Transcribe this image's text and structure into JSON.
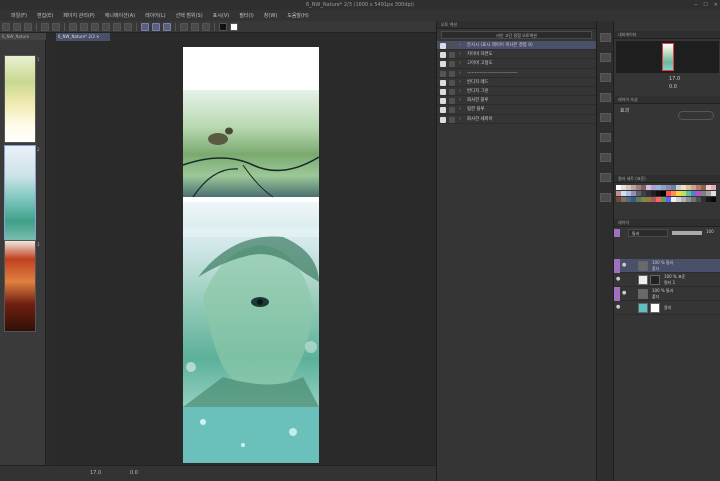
{
  "window": {
    "title": "6_NW_Nature* 2/3 (1600 x 5491px 300dpi)"
  },
  "menu": [
    "파일(F)",
    "편집(E)",
    "페이지 관리(P)",
    "애니메이션(A)",
    "레이어(L)",
    "선택 범위(S)",
    "표시(V)",
    "필터(I)",
    "창(W)",
    "도움말(H)"
  ],
  "navigator": {
    "tab": "6_NW_Nature",
    "pages": [
      {
        "num": "1"
      },
      {
        "num": "2"
      },
      {
        "num": "3"
      }
    ]
  },
  "document_tab": "6_NW_Nature* 2/3 ✕",
  "status": {
    "zoom": "17.0",
    "angle": "0.0"
  },
  "quick_access": {
    "tab": "오토 액션",
    "set": "라인 고단 정점 오토액션",
    "actions": [
      {
        "label": "분사시 (표시 레이어 복사본 결합 0)",
        "on": true,
        "hl": true
      },
      {
        "label": "지이비 자연도",
        "on": true
      },
      {
        "label": "고이비 고정도",
        "on": true
      },
      {
        "label": "--------------------------------",
        "on": false
      },
      {
        "label": "반디지 레드",
        "on": true
      },
      {
        "label": "반디지 그린",
        "on": true
      },
      {
        "label": "화사한 블루",
        "on": true
      },
      {
        "label": "핑한 블루",
        "on": true
      },
      {
        "label": "화사한 세피아",
        "on": true
      }
    ]
  },
  "navigator_panel": {
    "tab": "내비게이터",
    "zoom": "17.0",
    "angle": "0.0"
  },
  "subpanel": {
    "tab": "레이어 속성",
    "label": "효과"
  },
  "color_panel": {
    "tab": "컬러 세트 (표준)"
  },
  "layer_panel": {
    "tab": "레이어",
    "blend": "통과",
    "opacity": "100",
    "layers": [
      {
        "name": "100 % 통과",
        "sub": "폴더",
        "hl": true
      },
      {
        "name": "100 % 표준",
        "sub": "필터 1"
      },
      {
        "name": "100 % 통과",
        "sub": "폴더"
      },
      {
        "name": "용지",
        "sub": ""
      }
    ]
  },
  "colors": {
    "swatches": [
      "#ffffff",
      "#e8e0d0",
      "#d0c8c0",
      "#c0a0a0",
      "#a08080",
      "#806060",
      "#d0c0e0",
      "#b0a0d0",
      "#a0b0d0",
      "#90a0c0",
      "#8090b0",
      "#7080a0",
      "#c0d0e0",
      "#f0e0c0",
      "#e0c0a0",
      "#d0a090",
      "#b08070",
      "#906050",
      "#f0d0d0",
      "#e0b0b0",
      "#c09090",
      "#d0e0f0",
      "#b0c0e0",
      "#9090b0",
      "#606070",
      "#404048",
      "#303038",
      "#202028",
      "#101010",
      "#000000",
      "#ff5050",
      "#ff9050",
      "#ffd050",
      "#c0e060",
      "#60c0a0",
      "#5080d0",
      "#c050c0",
      "#808080",
      "#a0a0a0",
      "#e0e0e0",
      "#6a4a3a",
      "#8a6a5a",
      "#4a6a8a",
      "#3a5a7a",
      "#5a7a5a",
      "#7a8a4a",
      "#9a7a3a",
      "#aa5a5a",
      "#ff6060",
      "#60a060",
      "#6060ff",
      "#f0f0f0",
      "#d0d0d0",
      "#b0b0b0",
      "#909090",
      "#707070",
      "#505050",
      "#303030",
      "#181818",
      "#080808"
    ]
  }
}
